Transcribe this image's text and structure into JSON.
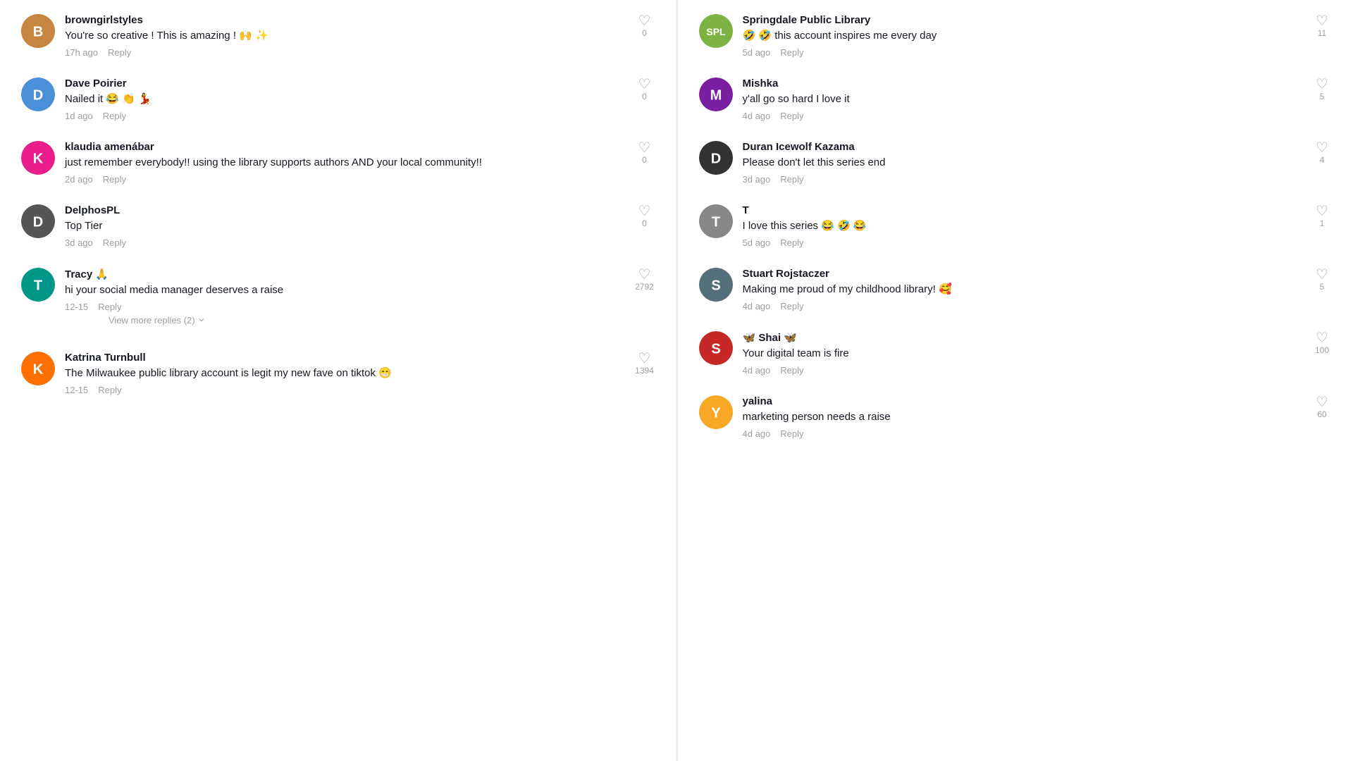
{
  "left_column": {
    "comments": [
      {
        "id": "c1",
        "username": "browngirlstyles",
        "avatar_letter": "B",
        "avatar_color": "av-brown",
        "text": "You're so creative ! This is amazing ! 🙌 ✨",
        "timestamp": "17h ago",
        "reply_label": "Reply",
        "likes": "0"
      },
      {
        "id": "c2",
        "username": "Dave Poirier",
        "avatar_letter": "D",
        "avatar_color": "av-blue",
        "text": "Nailed it 😂 👏 💃",
        "timestamp": "1d ago",
        "reply_label": "Reply",
        "likes": "0"
      },
      {
        "id": "c3",
        "username": "klaudia amenábar",
        "avatar_letter": "K",
        "avatar_color": "av-pink",
        "text": "just remember everybody!! using the library supports authors AND your local community!!",
        "timestamp": "2d ago",
        "reply_label": "Reply",
        "likes": "0"
      },
      {
        "id": "c4",
        "username": "DelphosPL",
        "avatar_letter": "D",
        "avatar_color": "av-gray",
        "text": "Top Tier",
        "timestamp": "3d ago",
        "reply_label": "Reply",
        "likes": "0"
      },
      {
        "id": "c5",
        "username": "Tracy 🙏",
        "avatar_letter": "T",
        "avatar_color": "av-teal",
        "text": "hi your social media manager deserves a raise",
        "timestamp": "12-15",
        "reply_label": "Reply",
        "likes": "2792",
        "has_replies": true,
        "view_more_label": "View more replies (2)"
      },
      {
        "id": "c6",
        "username": "Katrina Turnbull",
        "avatar_letter": "K",
        "avatar_color": "av-orange",
        "text": "The Milwaukee public library account is legit my new fave on tiktok 😁",
        "timestamp": "12-15",
        "reply_label": "Reply",
        "likes": "1394"
      }
    ]
  },
  "right_column": {
    "comments": [
      {
        "id": "r1",
        "username": "Springdale Public Library",
        "avatar_letter": "S",
        "avatar_color": "av-green",
        "text": "🤣 🤣 this account inspires me every day",
        "timestamp": "5d ago",
        "reply_label": "Reply",
        "likes": "11"
      },
      {
        "id": "r2",
        "username": "Mishka",
        "avatar_letter": "M",
        "avatar_color": "av-purple",
        "text": "y'all go so hard I love it",
        "timestamp": "4d ago",
        "reply_label": "Reply",
        "likes": "5"
      },
      {
        "id": "r3",
        "username": "Duran Icewolf Kazama",
        "avatar_letter": "D",
        "avatar_color": "av-dark",
        "text": "Please don't let this series end",
        "timestamp": "3d ago",
        "reply_label": "Reply",
        "likes": "4"
      },
      {
        "id": "r4",
        "username": "T",
        "avatar_letter": "T",
        "avatar_color": "av-gray",
        "text": "I love this series 😂 🤣 😂",
        "timestamp": "5d ago",
        "reply_label": "Reply",
        "likes": "1"
      },
      {
        "id": "r5",
        "username": "Stuart Rojstaczer",
        "avatar_letter": "S",
        "avatar_color": "av-navy",
        "text": "Making me proud of my childhood library! 🥰",
        "timestamp": "4d ago",
        "reply_label": "Reply",
        "likes": "5"
      },
      {
        "id": "r6",
        "username": "🦋 Shai 🦋",
        "avatar_letter": "S",
        "avatar_color": "av-red",
        "text": "Your digital team is fire",
        "timestamp": "4d ago",
        "reply_label": "Reply",
        "likes": "100"
      },
      {
        "id": "r7",
        "username": "yalina",
        "avatar_letter": "Y",
        "avatar_color": "av-yellow",
        "text": "marketing person needs a raise",
        "timestamp": "4d ago",
        "reply_label": "Reply",
        "likes": "60"
      }
    ]
  },
  "icons": {
    "heart": "♡",
    "chevron_down": "›"
  }
}
